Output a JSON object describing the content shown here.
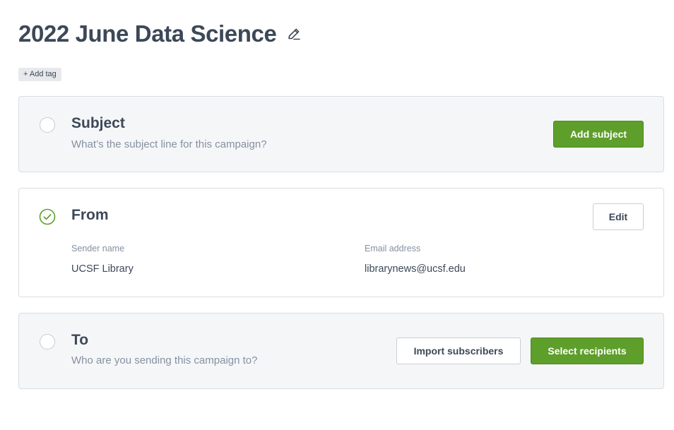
{
  "campaign": {
    "title": "2022 June Data Science",
    "add_tag_label": "+ Add tag"
  },
  "subject": {
    "title": "Subject",
    "description": "What’s the subject line for this campaign?",
    "button_label": "Add subject",
    "completed": false
  },
  "from": {
    "title": "From",
    "edit_label": "Edit",
    "completed": true,
    "sender_name_label": "Sender name",
    "sender_name": "UCSF Library",
    "email_label": "Email address",
    "email": "librarynews@ucsf.edu"
  },
  "to": {
    "title": "To",
    "description": "Who are you sending this campaign to?",
    "import_label": "Import subscribers",
    "select_label": "Select recipients",
    "completed": false
  },
  "colors": {
    "primary_green": "#5e9e2b",
    "check_green": "#5e9e2b",
    "text_dark": "#3c4858",
    "text_muted": "#8591a1"
  },
  "icons": {
    "title_edit": "pencil-icon",
    "from_status": "check-circle-icon"
  }
}
